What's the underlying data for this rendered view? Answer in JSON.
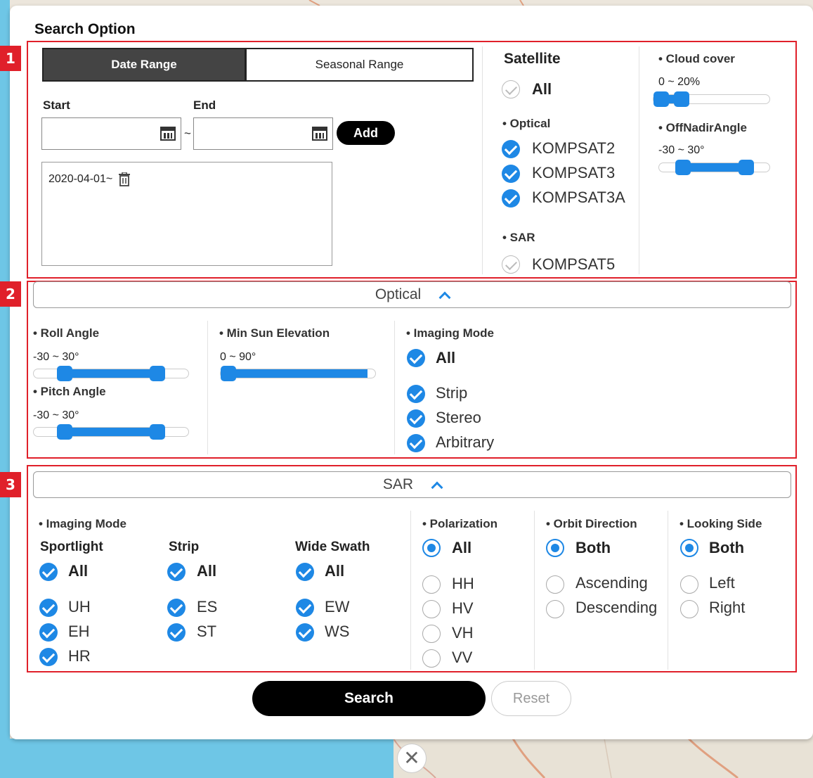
{
  "panel": {
    "title": "Search Option"
  },
  "badges": [
    "1",
    "2",
    "3"
  ],
  "tabs": {
    "date_range": "Date Range",
    "seasonal_range": "Seasonal Range"
  },
  "dates": {
    "start_label": "Start",
    "end_label": "End",
    "start_value": "",
    "end_value": "",
    "separator": "~",
    "add_label": "Add",
    "entries": [
      "2020-04-01~"
    ]
  },
  "satellite": {
    "title": "Satellite",
    "all_label": "All",
    "all_checked": false,
    "optical_title": "• Optical",
    "optical": [
      {
        "label": "KOMPSAT2",
        "checked": true
      },
      {
        "label": "KOMPSAT3",
        "checked": true
      },
      {
        "label": "KOMPSAT3A",
        "checked": true
      }
    ],
    "sar_title": "• SAR",
    "sar": [
      {
        "label": "KOMPSAT5",
        "checked": false
      }
    ]
  },
  "cloud_cover": {
    "title": "• Cloud cover",
    "range_text": "0 ~ 20%",
    "min": 0,
    "max": 20,
    "domain": [
      0,
      100
    ]
  },
  "off_nadir": {
    "title": "• OffNadirAngle",
    "range_text": "-30 ~ 30°",
    "min": -30,
    "max": 30,
    "domain": [
      -45,
      45
    ]
  },
  "optical": {
    "header": "Optical",
    "roll": {
      "title": "• Roll Angle",
      "range_text": "-30 ~ 30°",
      "min": -30,
      "max": 30,
      "domain": [
        -45,
        45
      ]
    },
    "pitch": {
      "title": "• Pitch Angle",
      "range_text": "-30 ~ 30°",
      "min": -30,
      "max": 30,
      "domain": [
        -45,
        45
      ]
    },
    "sun": {
      "title": "• Min Sun Elevation",
      "range_text": "0 ~ 90°",
      "min": 0,
      "max": 90,
      "domain": [
        0,
        90
      ]
    },
    "imaging_mode": {
      "title": "• Imaging Mode",
      "all_label": "All",
      "items": [
        "Strip",
        "Stereo",
        "Arbitrary"
      ]
    }
  },
  "sar": {
    "header": "SAR",
    "imaging_mode_title": "• Imaging Mode",
    "groups": [
      {
        "name": "Sportlight",
        "all": "All",
        "items": [
          "UH",
          "EH",
          "HR"
        ]
      },
      {
        "name": "Strip",
        "all": "All",
        "items": [
          "ES",
          "ST"
        ]
      },
      {
        "name": "Wide Swath",
        "all": "All",
        "items": [
          "EW",
          "WS"
        ]
      }
    ],
    "polarization": {
      "title": "• Polarization",
      "selected": "All",
      "options": [
        "HH",
        "HV",
        "VH",
        "VV"
      ]
    },
    "orbit": {
      "title": "• Orbit Direction",
      "selected": "Both",
      "options": [
        "Ascending",
        "Descending"
      ]
    },
    "looking": {
      "title": "• Looking Side",
      "selected": "Both",
      "options": [
        "Left",
        "Right"
      ]
    }
  },
  "actions": {
    "search_label": "Search",
    "reset_label": "Reset"
  },
  "colors": {
    "accent": "#1e88e5",
    "highlight": "#e0202a",
    "primary_button": "#000000"
  },
  "icons": {
    "calendar": "calendar-icon",
    "trash": "trash-icon",
    "close": "close-icon",
    "chevron": "chevron-up-icon"
  }
}
